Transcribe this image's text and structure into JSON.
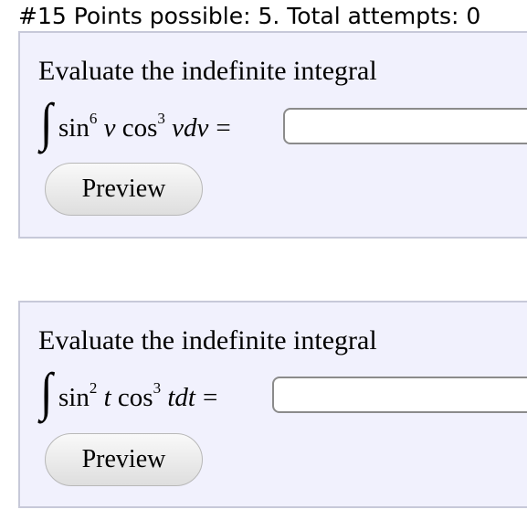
{
  "header": {
    "title": "#15 Points possible: 5. Total attempts: 0"
  },
  "problems": [
    {
      "prompt": "Evaluate the indefinite integral",
      "integrand": {
        "sin": "sin",
        "sin_power": "6",
        "var1": "v",
        "cos": "cos",
        "cos_power": "3",
        "differential": "vdv"
      },
      "equals": "=",
      "answer_value": "",
      "preview_label": "Preview"
    },
    {
      "prompt": "Evaluate the indefinite integral",
      "integrand": {
        "sin": "sin",
        "sin_power": "2",
        "var1": "t",
        "cos": "cos",
        "cos_power": "3",
        "differential": "tdt"
      },
      "equals": "=",
      "answer_value": "",
      "preview_label": "Preview"
    }
  ],
  "colors": {
    "box_background": "#f1f1fd",
    "box_border": "#c7c9d9",
    "input_border": "#8b8b8b"
  }
}
